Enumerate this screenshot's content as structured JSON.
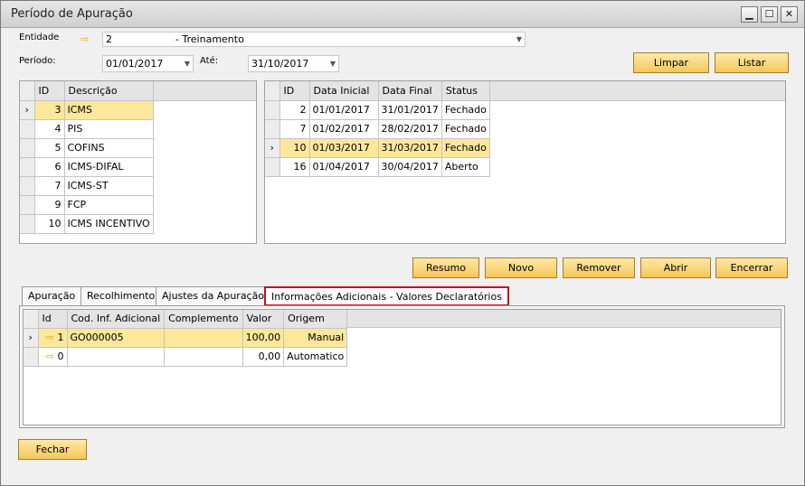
{
  "window": {
    "title": "Período de Apuração",
    "controls": {
      "minimize": "▁",
      "maximize": "☐",
      "close": "✕"
    }
  },
  "filters": {
    "entidade_label": "Entidade",
    "entidade_value": "2                    - Treinamento",
    "periodo_label": "Período:",
    "periodo_value": "01/01/2017",
    "ate_label": "Até:",
    "ate_value": "31/10/2017"
  },
  "buttons": {
    "limpar": "Limpar",
    "listar": "Listar",
    "resumo": "Resumo",
    "novo": "Novo",
    "remover": "Remover",
    "abrir": "Abrir",
    "encerrar": "Encerrar",
    "fechar": "Fechar"
  },
  "impostos": {
    "columns": [
      "ID",
      "Descrição"
    ],
    "rows": [
      {
        "id": "3",
        "descricao": "ICMS"
      },
      {
        "id": "4",
        "descricao": "PIS"
      },
      {
        "id": "5",
        "descricao": "COFINS"
      },
      {
        "id": "6",
        "descricao": "ICMS-DIFAL"
      },
      {
        "id": "7",
        "descricao": "ICMS-ST"
      },
      {
        "id": "9",
        "descricao": "FCP"
      },
      {
        "id": "10",
        "descricao": "ICMS INCENTIVO"
      }
    ]
  },
  "periodos": {
    "columns": [
      "ID",
      "Data Inicial",
      "Data Final",
      "Status"
    ],
    "rows": [
      {
        "id": "2",
        "inicial": "01/01/2017",
        "final": "31/01/2017",
        "status": "Fechado"
      },
      {
        "id": "7",
        "inicial": "01/02/2017",
        "final": "28/02/2017",
        "status": "Fechado"
      },
      {
        "id": "10",
        "inicial": "01/03/2017",
        "final": "31/03/2017",
        "status": "Fechado"
      },
      {
        "id": "16",
        "inicial": "01/04/2017",
        "final": "30/04/2017",
        "status": "Aberto"
      }
    ]
  },
  "tabs": [
    {
      "label": "Apuração"
    },
    {
      "label": "Recolhimento"
    },
    {
      "label": "Ajustes da Apuração"
    },
    {
      "label": "Informações Adicionais - Valores Declaratórios"
    }
  ],
  "info_adicionais": {
    "columns": [
      "Id",
      "Cod. Inf. Adicional",
      "Complemento",
      "Valor",
      "Origem"
    ],
    "rows": [
      {
        "id": "1",
        "codigo": "GO000005",
        "complemento": "",
        "valor": "100,00",
        "origem": "Manual"
      },
      {
        "id": "0",
        "codigo": "",
        "complemento": "",
        "valor": "0,00",
        "origem": "Automatico"
      }
    ]
  },
  "colors": {
    "accent": "#f4c65a",
    "selected_row": "#fde79a",
    "active_tab_border": "#c0141c"
  }
}
